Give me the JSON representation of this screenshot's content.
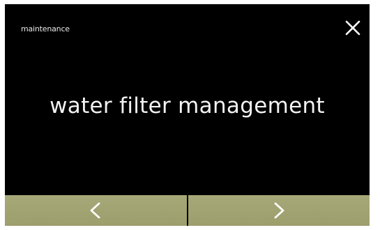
{
  "header": {
    "title": "maintenance",
    "close_icon": "close-icon"
  },
  "main": {
    "title": "water filter management"
  },
  "navigation": {
    "previous_icon": "chevron-left-icon",
    "next_icon": "chevron-right-icon"
  },
  "colors": {
    "background": "#000000",
    "text": "#f2f2f2",
    "nav_button": "#a2a472",
    "nav_icon": "#ffffff"
  }
}
